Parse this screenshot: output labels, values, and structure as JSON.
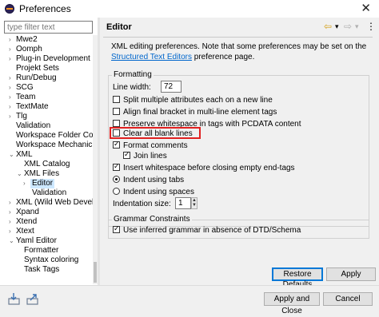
{
  "window": {
    "title": "Preferences",
    "close_glyph": "✕"
  },
  "filter": {
    "placeholder": "type filter text"
  },
  "tree": [
    {
      "label": "Mwe2",
      "arrow": "›"
    },
    {
      "label": "Oomph",
      "arrow": "›"
    },
    {
      "label": "Plug-in Development",
      "arrow": "›"
    },
    {
      "label": "Projekt Sets",
      "arrow": ""
    },
    {
      "label": "Run/Debug",
      "arrow": "›"
    },
    {
      "label": "SCG",
      "arrow": "›"
    },
    {
      "label": "Team",
      "arrow": "›"
    },
    {
      "label": "TextMate",
      "arrow": "›"
    },
    {
      "label": "Tlg",
      "arrow": "›"
    },
    {
      "label": "Validation",
      "arrow": ""
    },
    {
      "label": "Workspace Folder Conta",
      "arrow": ""
    },
    {
      "label": "Workspace Mechanic",
      "arrow": ""
    },
    {
      "label": "XML",
      "arrow": "⌄"
    },
    {
      "label": "XML Catalog",
      "arrow": ""
    },
    {
      "label": "XML Files",
      "arrow": "⌄"
    },
    {
      "label": "Editor",
      "arrow": "›"
    },
    {
      "label": "Validation",
      "arrow": ""
    },
    {
      "label": "XML (Wild Web Develop",
      "arrow": "›"
    },
    {
      "label": "Xpand",
      "arrow": "›"
    },
    {
      "label": "Xtend",
      "arrow": "›"
    },
    {
      "label": "Xtext",
      "arrow": "›"
    },
    {
      "label": "Yaml Editor",
      "arrow": "⌄"
    },
    {
      "label": "Formatter",
      "arrow": ""
    },
    {
      "label": "Syntax coloring",
      "arrow": ""
    },
    {
      "label": "Task Tags",
      "arrow": ""
    }
  ],
  "page": {
    "title": "Editor",
    "nav_back": "⇦",
    "nav_back_menu": "▾",
    "nav_fwd": "⇨",
    "nav_fwd_menu": "▾",
    "nav_more": "⋮",
    "desc_pre": "XML editing preferences.  Note that some preferences may be set on the ",
    "desc_link": "Structured Text Editors",
    "desc_post": " preference page."
  },
  "formatting": {
    "label": "Formatting",
    "line_width_label": "Line width:",
    "line_width_value": "72",
    "split_attrs": "Split multiple attributes each on a new line",
    "align_bracket": "Align final bracket in multi-line element tags",
    "preserve_ws": "Preserve whitespace in tags with PCDATA content",
    "clear_blank": "Clear all blank lines",
    "format_comments": "Format comments",
    "join_lines": "Join lines",
    "insert_ws": "Insert whitespace before closing empty end-tags",
    "indent_tabs": "Indent using tabs",
    "indent_spaces": "Indent using spaces",
    "indent_size_label": "Indentation size:",
    "indent_size_value": "1"
  },
  "grammar": {
    "label": "Grammar Constraints",
    "use_inferred": "Use inferred grammar in absence of DTD/Schema"
  },
  "buttons": {
    "restore": "Restore Defaults",
    "apply": "Apply",
    "apply_close": "Apply and Close",
    "cancel": "Cancel"
  },
  "accent": "#0078d7",
  "highlight_color": "#e02020"
}
